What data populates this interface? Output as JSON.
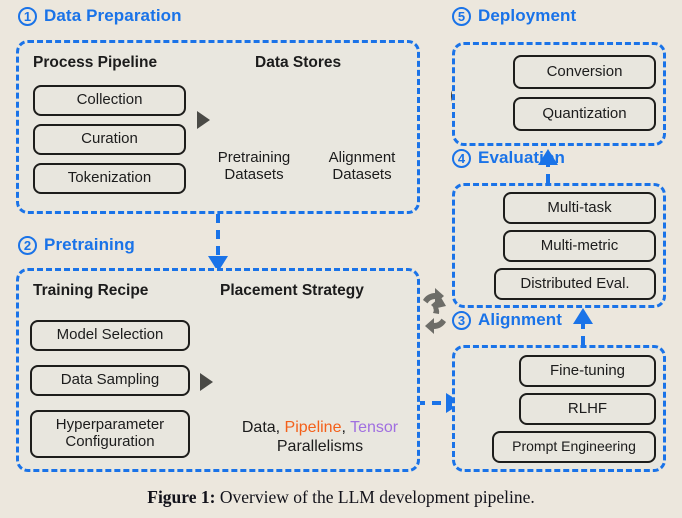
{
  "figure": {
    "label": "Figure 1:",
    "caption": " Overview of the LLM development pipeline."
  },
  "colors": {
    "accent_blue": "#1a73e8",
    "background": "#ece7dd",
    "panel_fill": "#e9e7df",
    "box_stroke": "#1d1d1b",
    "alignment_db_red": "#ff0000",
    "pipeline_orange": "#f4601a",
    "tensor_purple": "#a06fe0",
    "arrow_gray": "#4a4a46"
  },
  "sections": [
    {
      "number": "1",
      "title": "Data Preparation",
      "columns": [
        {
          "title": "Process Pipeline",
          "items": [
            "Collection",
            "Curation",
            "Tokenization"
          ]
        },
        {
          "title": "Data Stores",
          "stores": [
            {
              "icon": "database-icon",
              "label": "Pretraining\nDatasets",
              "color": "#333333"
            },
            {
              "icon": "database-icon",
              "label": "Alignment\nDatasets",
              "color": "#ff0000"
            }
          ]
        }
      ]
    },
    {
      "number": "2",
      "title": "Pretraining",
      "columns": [
        {
          "title": "Training Recipe",
          "items": [
            "Model Selection",
            "Data Sampling",
            "Hyperparameter\nConfiguration"
          ]
        },
        {
          "title": "Placement Strategy",
          "icon": "3d-blocks-icon",
          "legend": {
            "data": "Data, ",
            "pipeline": "Pipeline",
            "comma": ", ",
            "tensor": "Tensor",
            "suffix": "Parallelisms"
          }
        }
      ]
    },
    {
      "number": "3",
      "title": "Alignment",
      "icon": "gear-settings-icon",
      "items": [
        "Fine-tuning",
        "RLHF",
        "Prompt Engineering"
      ]
    },
    {
      "number": "4",
      "title": "Evaluation",
      "icon": "checklist-icon",
      "items": [
        "Multi-task",
        "Multi-metric",
        "Distributed Eval."
      ]
    },
    {
      "number": "5",
      "title": "Deployment",
      "icon": "cloud-upload-icon",
      "items": [
        "Conversion",
        "Quantization"
      ]
    }
  ],
  "connectors": [
    {
      "name": "pipeline-to-stores-arrow",
      "type": "solid-triangle"
    },
    {
      "name": "dataprep-to-pretraining-arrow",
      "type": "dashed-down"
    },
    {
      "name": "recipe-to-placement-arrow",
      "type": "solid-triangle"
    },
    {
      "name": "pretraining-to-alignment-arrow",
      "type": "dashed-right"
    },
    {
      "name": "alignment-to-evaluation-arrow",
      "type": "dashed-up"
    },
    {
      "name": "evaluation-to-deployment-arrow",
      "type": "dashed-up"
    },
    {
      "name": "pretraining-alignment-sync-icon",
      "type": "circular-arrows"
    }
  ]
}
